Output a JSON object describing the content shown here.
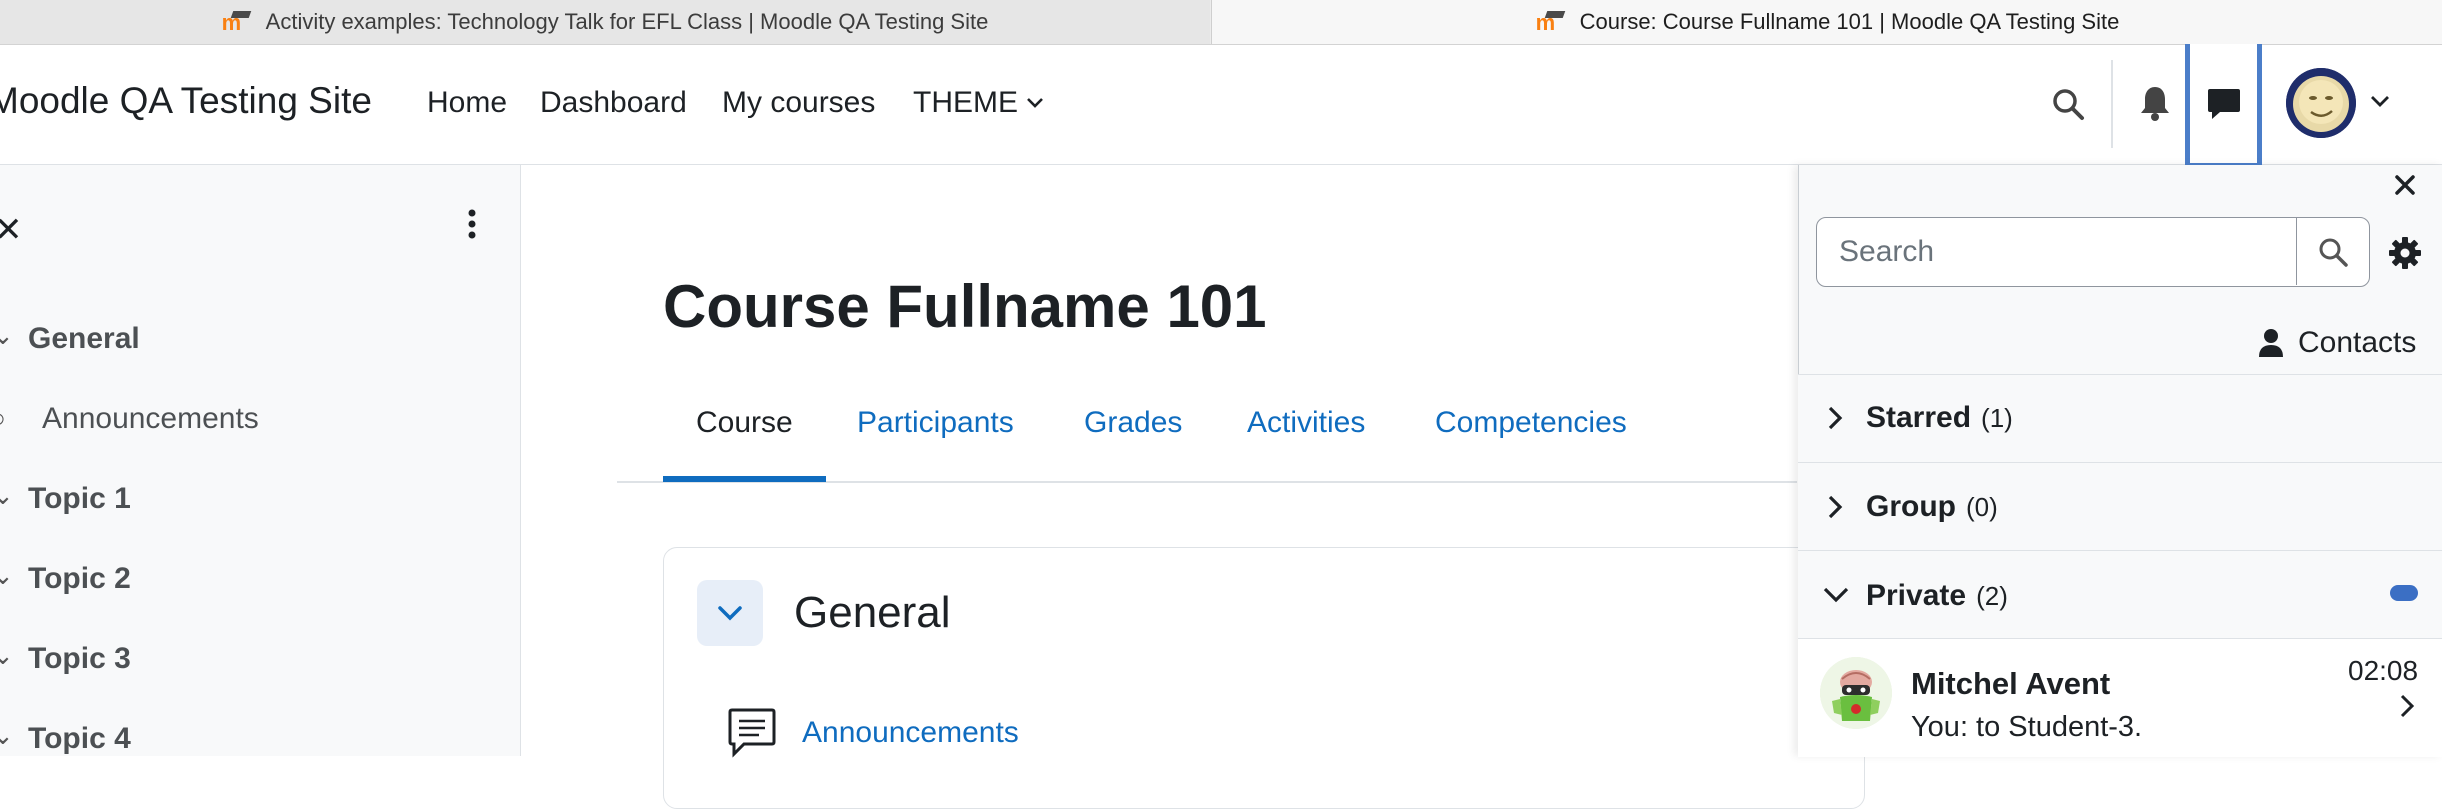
{
  "browser": {
    "tabs": [
      {
        "title": "Activity examples: Technology Talk for EFL Class | Moodle QA Testing Site",
        "active": false
      },
      {
        "title": "Course: Course Fullname 101 | Moodle QA Testing Site",
        "active": true
      }
    ],
    "favicon": "moodle-favicon"
  },
  "navbar": {
    "site_name": "Moodle QA Testing Site",
    "links": [
      "Home",
      "Dashboard",
      "My courses",
      "THEME"
    ],
    "icons": [
      "search-icon",
      "bell-icon",
      "message-icon",
      "user-avatar",
      "chevron-down-icon"
    ]
  },
  "course_index": {
    "items": [
      {
        "label": "General",
        "type": "section"
      },
      {
        "label": "Announcements",
        "type": "activity"
      },
      {
        "label": "Topic 1",
        "type": "section"
      },
      {
        "label": "Topic 2",
        "type": "section"
      },
      {
        "label": "Topic 3",
        "type": "section"
      },
      {
        "label": "Topic 4",
        "type": "section"
      }
    ]
  },
  "main": {
    "title": "Course Fullname 101",
    "tabs": [
      "Course",
      "Participants",
      "Grades",
      "Activities",
      "Competencies"
    ],
    "active_tab": "Course",
    "section": {
      "title": "General",
      "activity": "Announcements"
    }
  },
  "message_drawer": {
    "search_placeholder": "Search",
    "contacts_label": "Contacts",
    "groups": [
      {
        "label": "Starred",
        "count": "(1)",
        "expanded": false
      },
      {
        "label": "Group",
        "count": "(0)",
        "expanded": false
      },
      {
        "label": "Private",
        "count": "(2)",
        "expanded": true
      }
    ],
    "conversation": {
      "name": "Mitchel Avent",
      "preview": "You: to Student-3.",
      "time": "02:08"
    }
  },
  "colors": {
    "link": "#0f6cbf",
    "focus_outline": "#4b7ec9",
    "unread_pill": "#3b6fc4"
  }
}
